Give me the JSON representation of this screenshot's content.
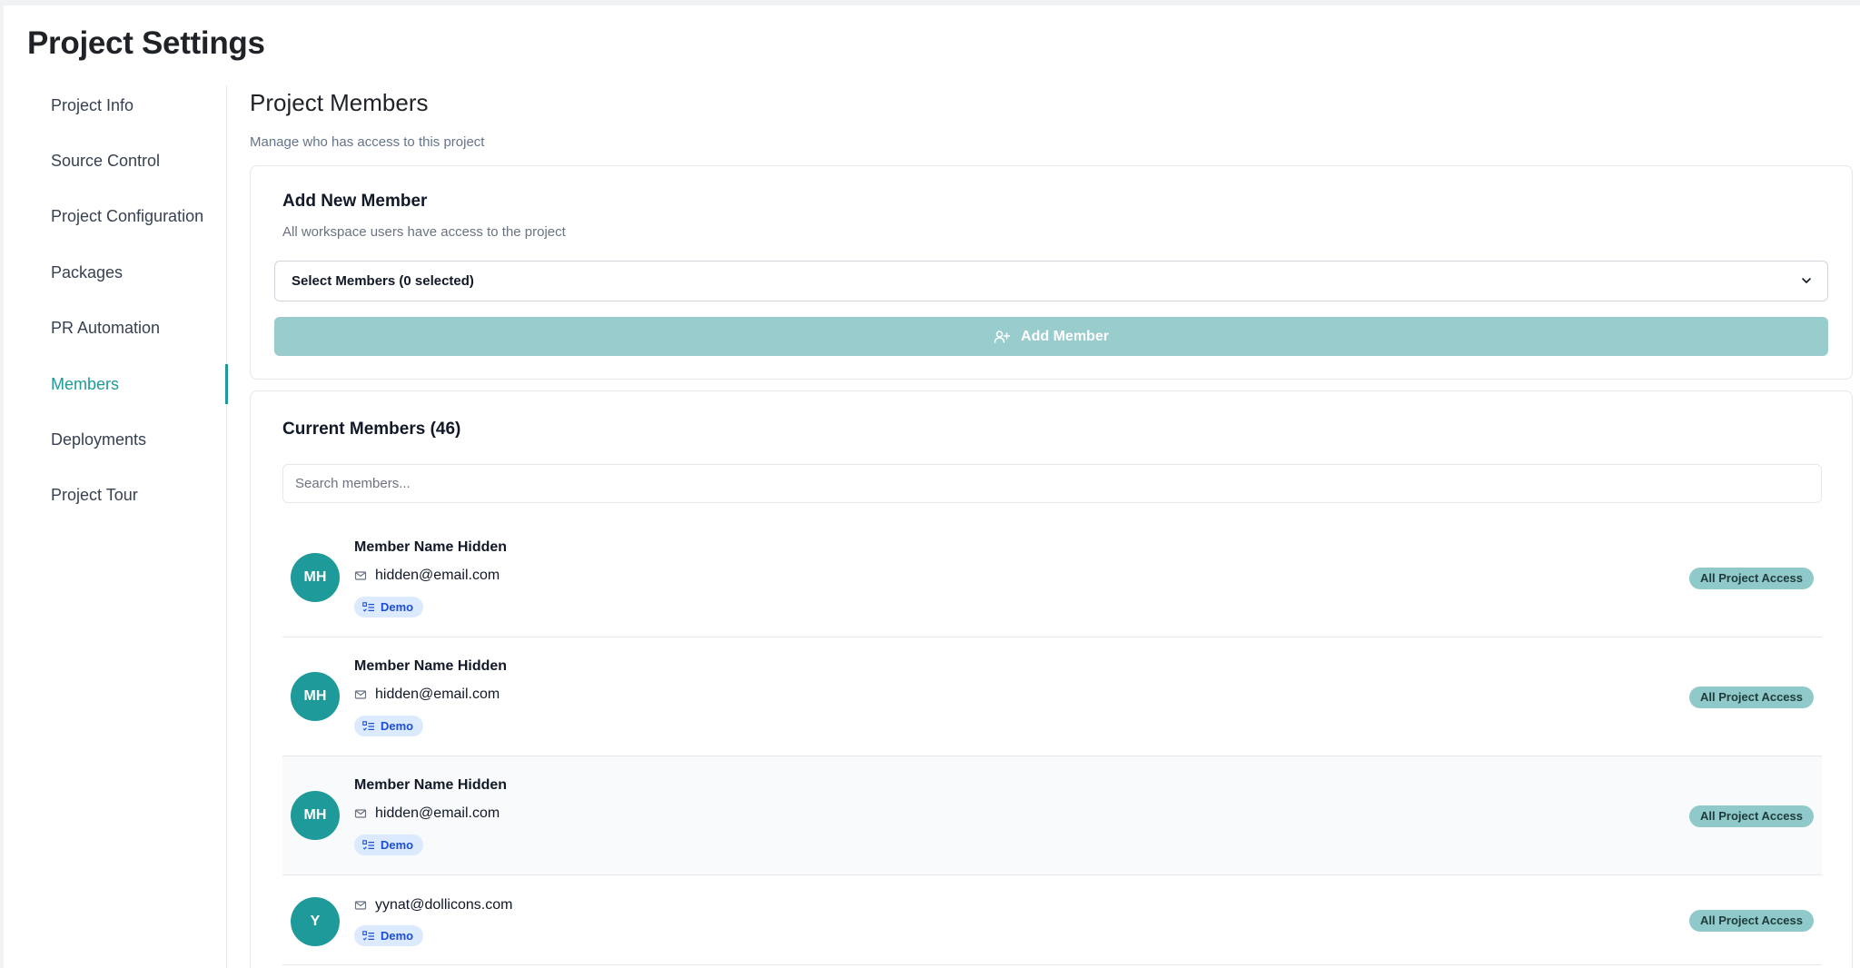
{
  "page": {
    "title": "Project Settings"
  },
  "sidebar": {
    "items": [
      {
        "label": "Project Info",
        "active": false
      },
      {
        "label": "Source Control",
        "active": false
      },
      {
        "label": "Project Configuration",
        "active": false
      },
      {
        "label": "Packages",
        "active": false
      },
      {
        "label": "PR Automation",
        "active": false
      },
      {
        "label": "Members",
        "active": true
      },
      {
        "label": "Deployments",
        "active": false
      },
      {
        "label": "Project Tour",
        "active": false
      }
    ]
  },
  "members_section": {
    "title": "Project Members",
    "subtitle": "Manage who has access to this project"
  },
  "add_member": {
    "title": "Add New Member",
    "subtitle": "All workspace users have access to the project",
    "select_value": "Select Members (0 selected)",
    "button_label": "Add Member"
  },
  "current_members": {
    "title": "Current Members (46)",
    "search_placeholder": "Search members...",
    "rows": [
      {
        "initials": "MH",
        "name": "Member Name Hidden",
        "email": "hidden@email.com",
        "tag": "Demo",
        "access": "All Project Access"
      },
      {
        "initials": "MH",
        "name": "Member Name Hidden",
        "email": "hidden@email.com",
        "tag": "Demo",
        "access": "All Project Access"
      },
      {
        "initials": "MH",
        "name": "Member Name Hidden",
        "email": "hidden@email.com",
        "tag": "Demo",
        "access": "All Project Access"
      },
      {
        "initials": "Y",
        "name": "",
        "email": "yynat@dollicons.com",
        "tag": "Demo",
        "access": "All Project Access"
      }
    ]
  },
  "colors": {
    "accent": "#1f9a9a",
    "button_disabled": "#99cccc",
    "tag_bg": "#dbeafe",
    "tag_text": "#1d4ed8",
    "access_badge": "#8fc9c9"
  },
  "icons": {
    "select_chevron": "chevron-down-icon",
    "add_button": "user-plus-icon",
    "email": "mail-icon",
    "tag": "list-checks-icon"
  }
}
